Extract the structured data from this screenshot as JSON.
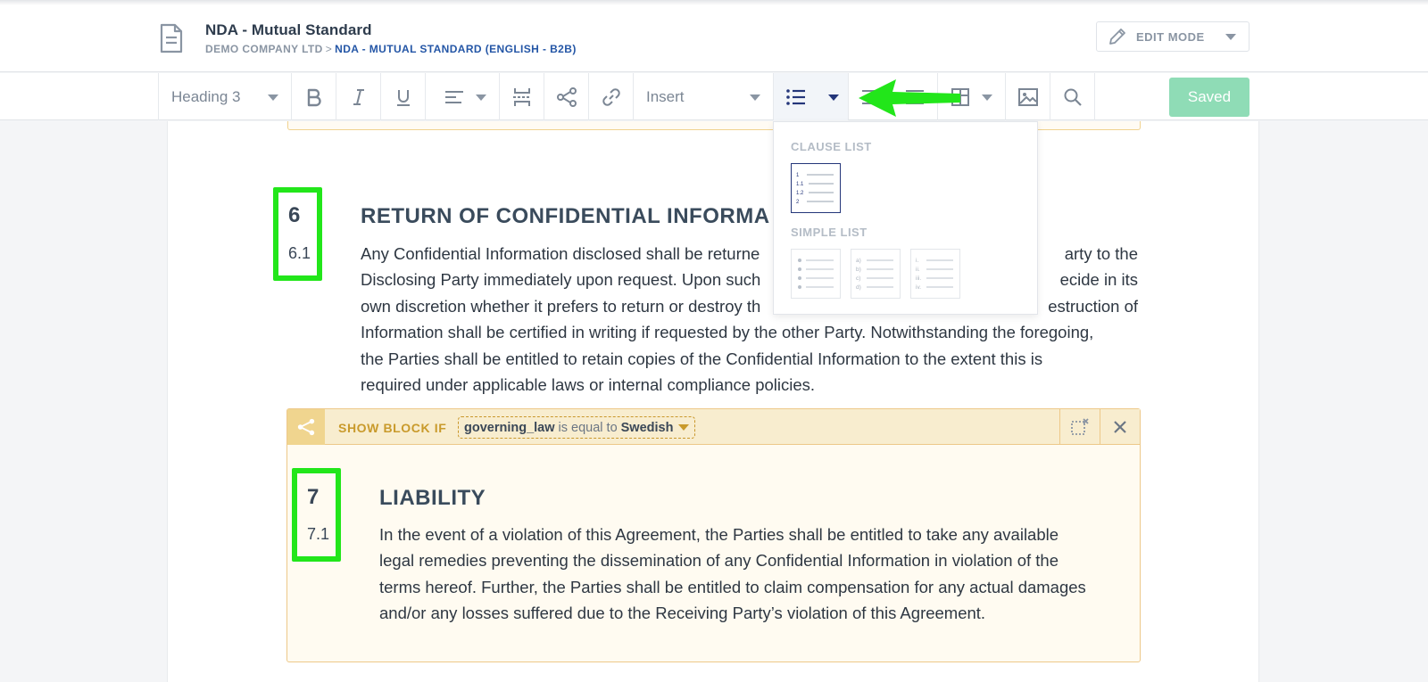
{
  "header": {
    "title": "NDA - Mutual Standard",
    "breadcrumb_company": "DEMO COMPANY LTD",
    "breadcrumb_sep": ">",
    "breadcrumb_doc": "NDA - MUTUAL STANDARD (ENGLISH - B2B)",
    "mode_label": "EDIT MODE"
  },
  "toolbar": {
    "style_select": "Heading 3",
    "insert_select": "Insert",
    "saved_label": "Saved"
  },
  "dropdown": {
    "clause_list_heading": "CLAUSE LIST",
    "clause_list_lines": [
      "1",
      "1.1",
      "1.2",
      "2"
    ],
    "simple_list_heading": "SIMPLE LIST",
    "alpha_markers": [
      "a)",
      "b)",
      "c)",
      "d)"
    ],
    "roman_markers": [
      "i.",
      "ii.",
      "iii.",
      "iv."
    ]
  },
  "clause6": {
    "number": "6",
    "sub_number": "6.1",
    "title": "RETURN OF CONFIDENTIAL INFORMA",
    "lines": [
      "Any Confidential Information disclosed shall be returne",
      "Disclosing Party immediately upon request. Upon such",
      "own discretion whether it prefers to return or destroy th",
      "Information shall be certified in writing if requested by the other Party. Notwithstanding the foregoing,",
      "the Parties shall be entitled to retain copies of the Confidential Information to the extent this is",
      "required under applicable laws or internal compliance policies."
    ],
    "right_fragments": [
      "arty to the",
      "ecide in its",
      "estruction of"
    ]
  },
  "condition": {
    "label": "SHOW BLOCK IF",
    "variable": "governing_law",
    "operator": "is equal to",
    "value": "Swedish"
  },
  "clause7": {
    "number": "7",
    "sub_number": "7.1",
    "title": "LIABILITY",
    "lines": [
      "In the event of a violation of this Agreement, the Parties shall be entitled to take any available",
      "legal remedies preventing the dissemination of any Confidential Information in violation of the",
      "terms hereof. Further, the Parties shall be entitled to claim compensation for any actual damages",
      "and/or any losses suffered due to the Receiving Party’s violation of this Agreement."
    ]
  },
  "colors": {
    "highlight": "#22e61a",
    "saved_bg": "#8fdcb6",
    "condition_accent": "#c99a2b",
    "link_blue": "#2456a6"
  }
}
